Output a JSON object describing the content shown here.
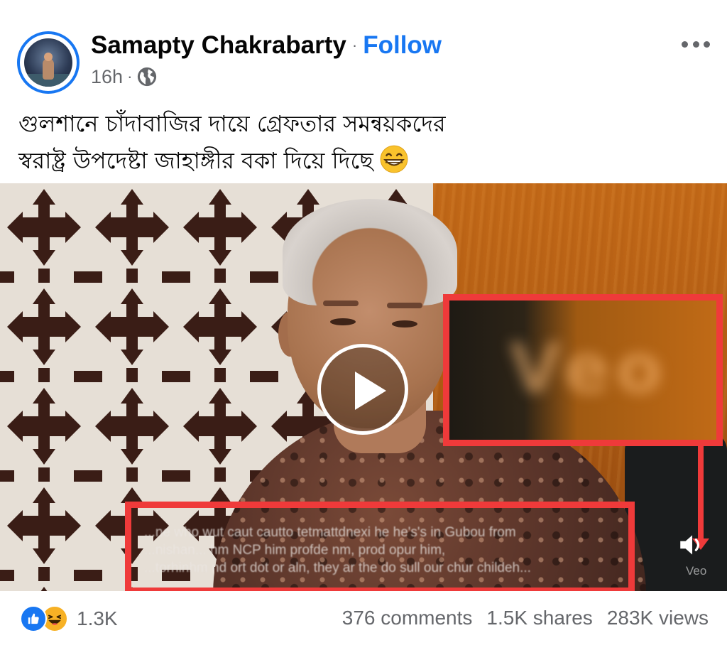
{
  "post": {
    "author": "Samapty Chakrabarty",
    "separator": "·",
    "follow_label": "Follow",
    "time": "16h",
    "time_separator": "·",
    "audience_icon": "globe-icon",
    "more_icon": "more-horizontal-icon",
    "caption_line_1": "গুলশানে চাঁদাবাজির দায়ে গ্রেফতার সমন্বয়কদের",
    "caption_line_2": "স্বরাষ্ট্র উপদেষ্টা জাহাঙ্গীর বকা দিয়ে দিছে",
    "caption_emoji": "grinning-face-emoji"
  },
  "video": {
    "play_icon": "play-icon",
    "watermark_blurred": "Veo",
    "watermark_small": "Veo",
    "subtitle_lines": [
      "...ne who wut caut cautto tetmattdnexi he he's's in Gubou from",
      "...nishan... hm NCP him profde nm, prod opur him,",
      "...torhinhm nd ort dot or aln, they ar the do sull our chur childeh..."
    ],
    "highlight_color": "#ef3a3a"
  },
  "footer": {
    "reaction_icons": [
      "like-reaction-icon",
      "haha-reaction-icon"
    ],
    "reaction_count": "1.3K",
    "comments": "376 comments",
    "shares": "1.5K shares",
    "views": "283K views"
  },
  "colors": {
    "brand_blue": "#1877f2",
    "secondary_text": "#65676b",
    "highlight_red": "#ef3a3a"
  }
}
